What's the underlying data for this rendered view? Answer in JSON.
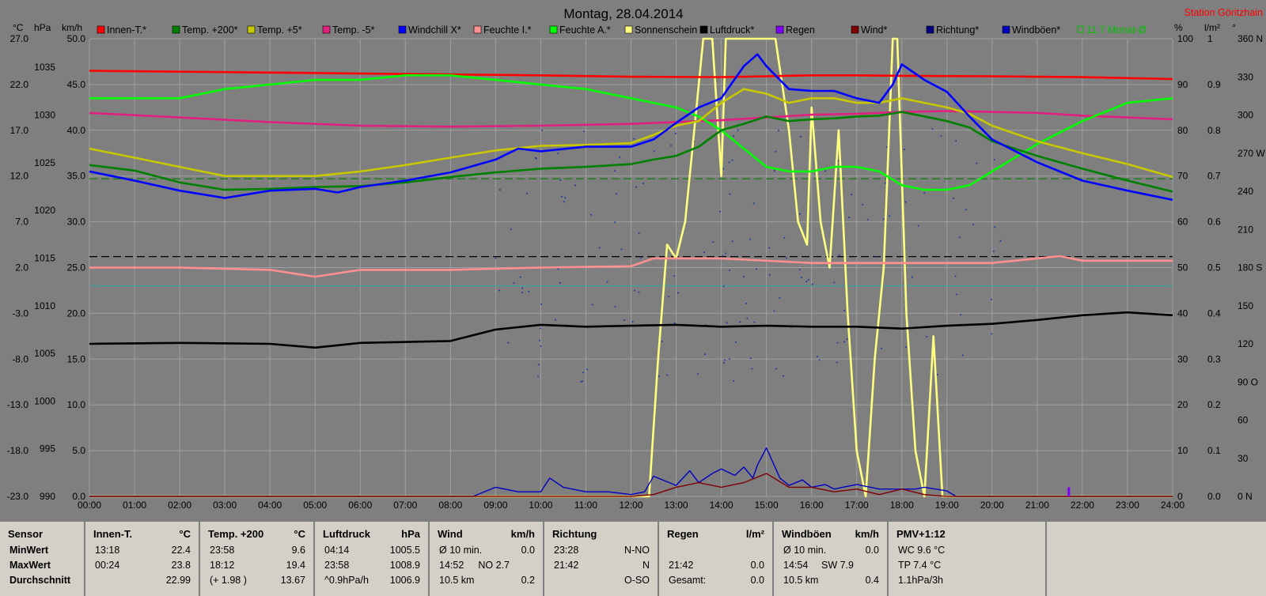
{
  "chart_data": {
    "type": "line",
    "title": "Montag, 28.04.2014",
    "station": "Station Göritzhain",
    "x_range": [
      "00:00",
      "24:00"
    ],
    "x_ticks": [
      "00:00",
      "01:00",
      "02:00",
      "03:00",
      "04:00",
      "05:00",
      "06:00",
      "07:00",
      "08:00",
      "09:00",
      "10:00",
      "11:00",
      "12:00",
      "13:00",
      "14:00",
      "15:00",
      "16:00",
      "17:00",
      "18:00",
      "19:00",
      "20:00",
      "21:00",
      "22:00",
      "23:00",
      "24:00"
    ],
    "axes": {
      "temp": {
        "unit": "°C",
        "min": -23,
        "max": 27,
        "ticks": [
          "27.0",
          "22.0",
          "17.0",
          "12.0",
          "7.0",
          "2.0",
          "-3.0",
          "-8.0",
          "-13.0",
          "-18.0",
          "-23.0"
        ],
        "tick_values": [
          27,
          22,
          17,
          12,
          7,
          2,
          -3,
          -8,
          -13,
          -18,
          -23
        ]
      },
      "pressure": {
        "unit": "hPa",
        "min": 990,
        "max": 1038,
        "ticks": [
          "1035",
          "1030",
          "1025",
          "1020",
          "1015",
          "1010",
          "1005",
          "1000",
          "995",
          "990"
        ],
        "tick_values": [
          1035,
          1030,
          1025,
          1020,
          1015,
          1010,
          1005,
          1000,
          995,
          990
        ]
      },
      "wind": {
        "unit": "km/h",
        "min": 0,
        "max": 50,
        "ticks": [
          "50.0",
          "45.0",
          "40.0",
          "35.0",
          "30.0",
          "25.0",
          "20.0",
          "15.0",
          "10.0",
          "5.0",
          "0.0"
        ],
        "tick_values": [
          50,
          45,
          40,
          35,
          30,
          25,
          20,
          15,
          10,
          5,
          0
        ]
      },
      "percent": {
        "unit": "%",
        "min": 0,
        "max": 100,
        "ticks": [
          "100",
          "90",
          "80",
          "70",
          "60",
          "50",
          "40",
          "30",
          "20",
          "10",
          "0"
        ],
        "tick_values": [
          100,
          90,
          80,
          70,
          60,
          50,
          40,
          30,
          20,
          10,
          0
        ]
      },
      "rain": {
        "unit": "l/m²",
        "min": 0,
        "max": 1,
        "ticks": [
          "1",
          "0.9",
          "0.8",
          "0.7",
          "0.6",
          "0.5",
          "0.4",
          "0.3",
          "0.2",
          "0.1",
          "0.0"
        ],
        "tick_values": [
          1,
          0.9,
          0.8,
          0.7,
          0.6,
          0.5,
          0.4,
          0.3,
          0.2,
          0.1,
          0
        ]
      },
      "direction": {
        "unit": "°",
        "min": 0,
        "max": 360,
        "ticks": [
          "360 N",
          "330",
          "300",
          "270 W",
          "240",
          "210",
          "180 S",
          "150",
          "120",
          "90 O",
          "60",
          "30",
          "0   N"
        ],
        "tick_values": [
          360,
          330,
          300,
          270,
          240,
          210,
          180,
          150,
          120,
          90,
          60,
          30,
          0
        ]
      }
    },
    "legend": [
      {
        "name": "Innen-T.*",
        "color": "#ff0000"
      },
      {
        "name": "Temp. +200*",
        "color": "#008000"
      },
      {
        "name": "Temp. +5*",
        "color": "#c8c800"
      },
      {
        "name": "Temp. -5*",
        "color": "#e0207f"
      },
      {
        "name": "Windchill X*",
        "color": "#0000ff"
      },
      {
        "name": "Feuchte I.*",
        "color": "#ff9090"
      },
      {
        "name": "Feuchte A.*",
        "color": "#00ff00"
      },
      {
        "name": "Sonnenschein",
        "color": "#ffff80"
      },
      {
        "name": "Luftdruck*",
        "color": "#000000"
      },
      {
        "name": "Regen",
        "color": "#8000ff"
      },
      {
        "name": "Wind*",
        "color": "#800000"
      },
      {
        "name": "Richtung*",
        "color": "#000080"
      },
      {
        "name": "Windböen*",
        "color": "#0000c0"
      }
    ],
    "monthly_avg_label": "11.7 Monat-Ø",
    "series": [
      {
        "name": "Innen-T.*",
        "axis": "temp",
        "color": "#ff0000",
        "x": [
          0,
          2,
          4,
          6,
          8,
          10,
          12,
          14,
          15,
          16,
          17,
          18,
          20,
          22,
          24
        ],
        "y": [
          23.5,
          23.4,
          23.3,
          23.2,
          23.1,
          23.0,
          22.85,
          22.8,
          22.9,
          23.0,
          23.0,
          22.95,
          22.9,
          22.8,
          22.6
        ]
      },
      {
        "name": "Temp. +200*",
        "axis": "temp",
        "color": "#008000",
        "x": [
          0,
          1,
          2,
          3,
          4,
          5,
          6,
          7,
          8,
          9,
          10,
          11,
          12,
          12.5,
          13,
          13.5,
          14,
          14.5,
          15,
          15.5,
          16,
          16.5,
          17,
          17.5,
          18,
          18.5,
          19,
          19.5,
          20,
          21,
          22,
          23,
          24
        ],
        "y": [
          13.2,
          12.6,
          11.3,
          10.5,
          10.6,
          10.8,
          10.9,
          11.3,
          11.9,
          12.4,
          12.8,
          13.0,
          13.3,
          13.8,
          14.2,
          15.2,
          17.0,
          17.7,
          18.5,
          18.0,
          18.2,
          18.3,
          18.5,
          18.6,
          19.0,
          18.5,
          18.0,
          17.3,
          15.8,
          14.2,
          12.8,
          11.5,
          10.3
        ]
      },
      {
        "name": "Temp. +5*",
        "axis": "temp",
        "color": "#c8c800",
        "x": [
          0,
          1,
          2,
          3,
          4,
          5,
          6,
          7,
          8,
          9,
          10,
          11,
          12,
          12.5,
          13,
          13.5,
          14,
          14.5,
          15,
          15.5,
          16,
          16.5,
          17,
          17.5,
          18,
          18.5,
          19,
          19.5,
          20,
          21,
          22,
          23,
          24
        ],
        "y": [
          15.0,
          14.0,
          13.0,
          12.0,
          12.0,
          12.0,
          12.5,
          13.2,
          14.0,
          14.8,
          15.3,
          15.4,
          15.6,
          16.5,
          17.5,
          18.0,
          20.0,
          21.5,
          21.0,
          20.0,
          20.5,
          20.5,
          20.0,
          20.0,
          20.5,
          20.0,
          19.5,
          18.8,
          17.5,
          15.8,
          14.5,
          13.3,
          11.9
        ]
      },
      {
        "name": "Temp. -5*",
        "axis": "temp",
        "color": "#e0207f",
        "x": [
          0,
          2,
          4,
          6,
          8,
          10,
          12,
          13,
          14,
          15,
          16,
          17,
          18,
          19,
          20,
          21,
          22,
          23,
          24
        ],
        "y": [
          18.9,
          18.4,
          17.9,
          17.5,
          17.4,
          17.5,
          17.7,
          17.9,
          18.1,
          18.4,
          18.7,
          18.8,
          19.0,
          19.1,
          19.0,
          18.9,
          18.6,
          18.4,
          18.2
        ]
      },
      {
        "name": "Windchill X*",
        "axis": "temp",
        "color": "#0000ff",
        "x": [
          0,
          1,
          2,
          3,
          4,
          5,
          5.5,
          6,
          7,
          8,
          9,
          9.5,
          10,
          11,
          12,
          12.5,
          13,
          13.5,
          14,
          14.5,
          14.8,
          15,
          15.5,
          16,
          16.5,
          17,
          17.5,
          17.8,
          18,
          18.5,
          19,
          19.5,
          20,
          21,
          22,
          23,
          24
        ],
        "y": [
          12.5,
          11.5,
          10.4,
          9.6,
          10.4,
          10.6,
          10.2,
          10.8,
          11.5,
          12.4,
          13.8,
          15.0,
          14.7,
          15.2,
          15.2,
          16.0,
          17.8,
          19.5,
          20.5,
          24.0,
          25.3,
          24.0,
          21.5,
          21.3,
          21.3,
          20.5,
          20.0,
          22.0,
          24.2,
          22.5,
          21.2,
          18.5,
          16.0,
          13.5,
          11.5,
          10.4,
          9.4
        ]
      },
      {
        "name": "Feuchte I.*",
        "axis": "percent",
        "color": "#ff9090",
        "x": [
          0,
          2,
          4,
          5,
          6,
          8,
          10,
          12,
          12.5,
          14,
          16,
          18,
          20,
          21,
          21.5,
          22,
          24
        ],
        "y": [
          50,
          50,
          49.5,
          48,
          49.5,
          49.5,
          50,
          50.3,
          52,
          52,
          51,
          51,
          51,
          52,
          52.5,
          51.5,
          51.5
        ]
      },
      {
        "name": "Feuchte A.*",
        "axis": "percent",
        "color": "#00ff00",
        "x": [
          0,
          1,
          2,
          3,
          4,
          5,
          6,
          7,
          8,
          9,
          10,
          11,
          12,
          12.5,
          13,
          13.5,
          14,
          14.5,
          15,
          15.5,
          16,
          16.5,
          17,
          17.5,
          18,
          18.5,
          19,
          19.5,
          20,
          21,
          22,
          23,
          24
        ],
        "y": [
          87,
          87,
          87,
          89,
          90,
          91,
          91,
          92,
          92,
          91,
          90,
          89,
          87,
          86,
          85,
          83,
          80,
          76,
          72,
          71,
          71,
          72,
          72,
          71,
          68,
          67,
          67,
          68,
          71,
          77,
          82,
          86,
          87
        ]
      },
      {
        "name": "Sonnenschein",
        "axis": "percent",
        "color": "#ffff80",
        "x": [
          0,
          12,
          12.4,
          12.6,
          12.8,
          13,
          13.2,
          13.4,
          13.6,
          13.8,
          14,
          14.1,
          14.2,
          14.3,
          14.6,
          14.9,
          15.2,
          15.5,
          15.7,
          15.9,
          16,
          16.2,
          16.4,
          16.6,
          16.8,
          17,
          17.2,
          17.4,
          17.6,
          17.8,
          17.9,
          18.1,
          18.3,
          18.5,
          18.7,
          18.9,
          19.1,
          19.5,
          24
        ],
        "y": [
          0,
          0,
          0,
          30,
          55,
          52,
          60,
          80,
          100,
          100,
          70,
          100,
          100,
          100,
          100,
          100,
          100,
          80,
          60,
          55,
          85,
          60,
          50,
          80,
          40,
          10,
          0,
          30,
          50,
          100,
          100,
          40,
          10,
          0,
          35,
          0,
          0,
          0,
          0
        ]
      },
      {
        "name": "Luftdruck*",
        "axis": "pressure",
        "color": "#000000",
        "x": [
          0,
          2,
          4,
          5,
          6,
          8,
          9,
          10,
          11,
          12,
          13,
          14,
          15,
          16,
          17,
          18,
          19,
          20,
          21,
          22,
          23,
          24
        ],
        "y": [
          1006,
          1006.1,
          1006,
          1005.6,
          1006.1,
          1006.3,
          1007.5,
          1008.0,
          1007.8,
          1007.9,
          1008.0,
          1007.8,
          1007.9,
          1007.8,
          1007.8,
          1007.6,
          1007.9,
          1008.1,
          1008.5,
          1009.0,
          1009.3,
          1009.0
        ]
      },
      {
        "name": "Wind*",
        "axis": "wind",
        "color": "#800000",
        "x": [
          0,
          12,
          12.5,
          13,
          13.5,
          14,
          14.5,
          15,
          15.5,
          16,
          16.5,
          17,
          17.5,
          18,
          18.5,
          19,
          20,
          21,
          24
        ],
        "y": [
          0,
          0,
          0.2,
          1.0,
          1.5,
          1.0,
          1.5,
          2.5,
          1.0,
          1.0,
          0.5,
          0.8,
          0.2,
          0.8,
          0.2,
          0,
          0,
          0,
          0
        ]
      },
      {
        "name": "Windböen*",
        "axis": "wind",
        "color": "#0000c0",
        "x": [
          0,
          8.5,
          9,
          9.5,
          10,
          10.2,
          10.5,
          11,
          11.5,
          12,
          12.3,
          12.5,
          13,
          13.3,
          13.5,
          13.8,
          14,
          14.3,
          14.5,
          14.7,
          14.8,
          15,
          15.3,
          15.5,
          15.8,
          16,
          16.3,
          16.5,
          17,
          17.5,
          17.8,
          18,
          18.3,
          18.5,
          19,
          19.2,
          24
        ],
        "y": [
          0,
          0,
          1,
          0.5,
          0.5,
          2,
          1,
          0.5,
          0.5,
          0.2,
          0.5,
          2.2,
          1.2,
          2.8,
          1.5,
          2.5,
          3.0,
          2.3,
          3.2,
          2.0,
          3.4,
          5.3,
          2.0,
          1.2,
          1.8,
          1.0,
          1.3,
          0.8,
          1.3,
          0.8,
          0.8,
          0.8,
          0.8,
          1.0,
          0.6,
          0,
          0
        ]
      },
      {
        "name": "Regen",
        "axis": "rain",
        "color": "#8000ff",
        "x": [
          21.7,
          21.7
        ],
        "y": [
          0,
          0.02
        ]
      }
    ],
    "reference_lines": [
      {
        "axis": "temp",
        "value": 11.7,
        "color": "#008000",
        "style": "dashed"
      },
      {
        "axis": "temp",
        "value": 3.2,
        "color": "#000000",
        "style": "dashed"
      },
      {
        "axis": "temp",
        "value": 0.0,
        "color": "#40a0a0",
        "style": "solid"
      }
    ],
    "grid": true
  },
  "stats": {
    "panels": [
      {
        "header": "Sensor",
        "unit": "",
        "rows": [
          [
            "MinWert",
            "",
            ""
          ],
          [
            "MaxWert",
            "",
            ""
          ],
          [
            "Durchschnitt",
            "",
            ""
          ]
        ]
      },
      {
        "header": "Innen-T.",
        "unit": "°C",
        "rows": [
          [
            "13:18",
            "",
            "22.4"
          ],
          [
            "00:24",
            "",
            "23.8"
          ],
          [
            "",
            "",
            "22.99"
          ]
        ]
      },
      {
        "header": "Temp. +200",
        "unit": "°C",
        "rows": [
          [
            "23:58",
            "",
            "9.6"
          ],
          [
            "18:12",
            "",
            "19.4"
          ],
          [
            "(+ 1.98 )",
            "",
            "13.67"
          ]
        ]
      },
      {
        "header": "Luftdruck",
        "unit": "hPa",
        "rows": [
          [
            "04:14",
            "",
            "1005.5"
          ],
          [
            "23:58",
            "",
            "1008.9"
          ],
          [
            "^0.9hPa/h",
            "",
            "1006.9"
          ]
        ]
      },
      {
        "header": "Wind",
        "unit": "km/h",
        "rows": [
          [
            "Ø 10 min.",
            "",
            "0.0"
          ],
          [
            "14:52",
            "NO 2.7",
            ""
          ],
          [
            "10.5 km",
            "",
            "0.2"
          ]
        ]
      },
      {
        "header": "Richtung",
        "unit": "",
        "rows": [
          [
            "23:28",
            "",
            "N-NO"
          ],
          [
            "21:42",
            "",
            "N"
          ],
          [
            "",
            "",
            "O-SO"
          ]
        ]
      },
      {
        "header": "Regen",
        "unit": "l/m²",
        "rows": [
          [
            "",
            "",
            ""
          ],
          [
            "21:42",
            "",
            "0.0"
          ],
          [
            "Gesamt:",
            "",
            "0.0"
          ]
        ]
      },
      {
        "header": "Windböen",
        "unit": "km/h",
        "rows": [
          [
            "Ø 10 min.",
            "",
            "0.0"
          ],
          [
            "14:54",
            "SW 7.9",
            ""
          ],
          [
            "10.5 km",
            "",
            "0.4"
          ]
        ]
      },
      {
        "header": "PMV+1:12",
        "unit": "",
        "rows": [
          [
            "WC 9.6 °C",
            "",
            ""
          ],
          [
            "TP 7.4 °C",
            "",
            ""
          ],
          [
            "1.1hPa/3h",
            "",
            ""
          ]
        ]
      }
    ]
  }
}
